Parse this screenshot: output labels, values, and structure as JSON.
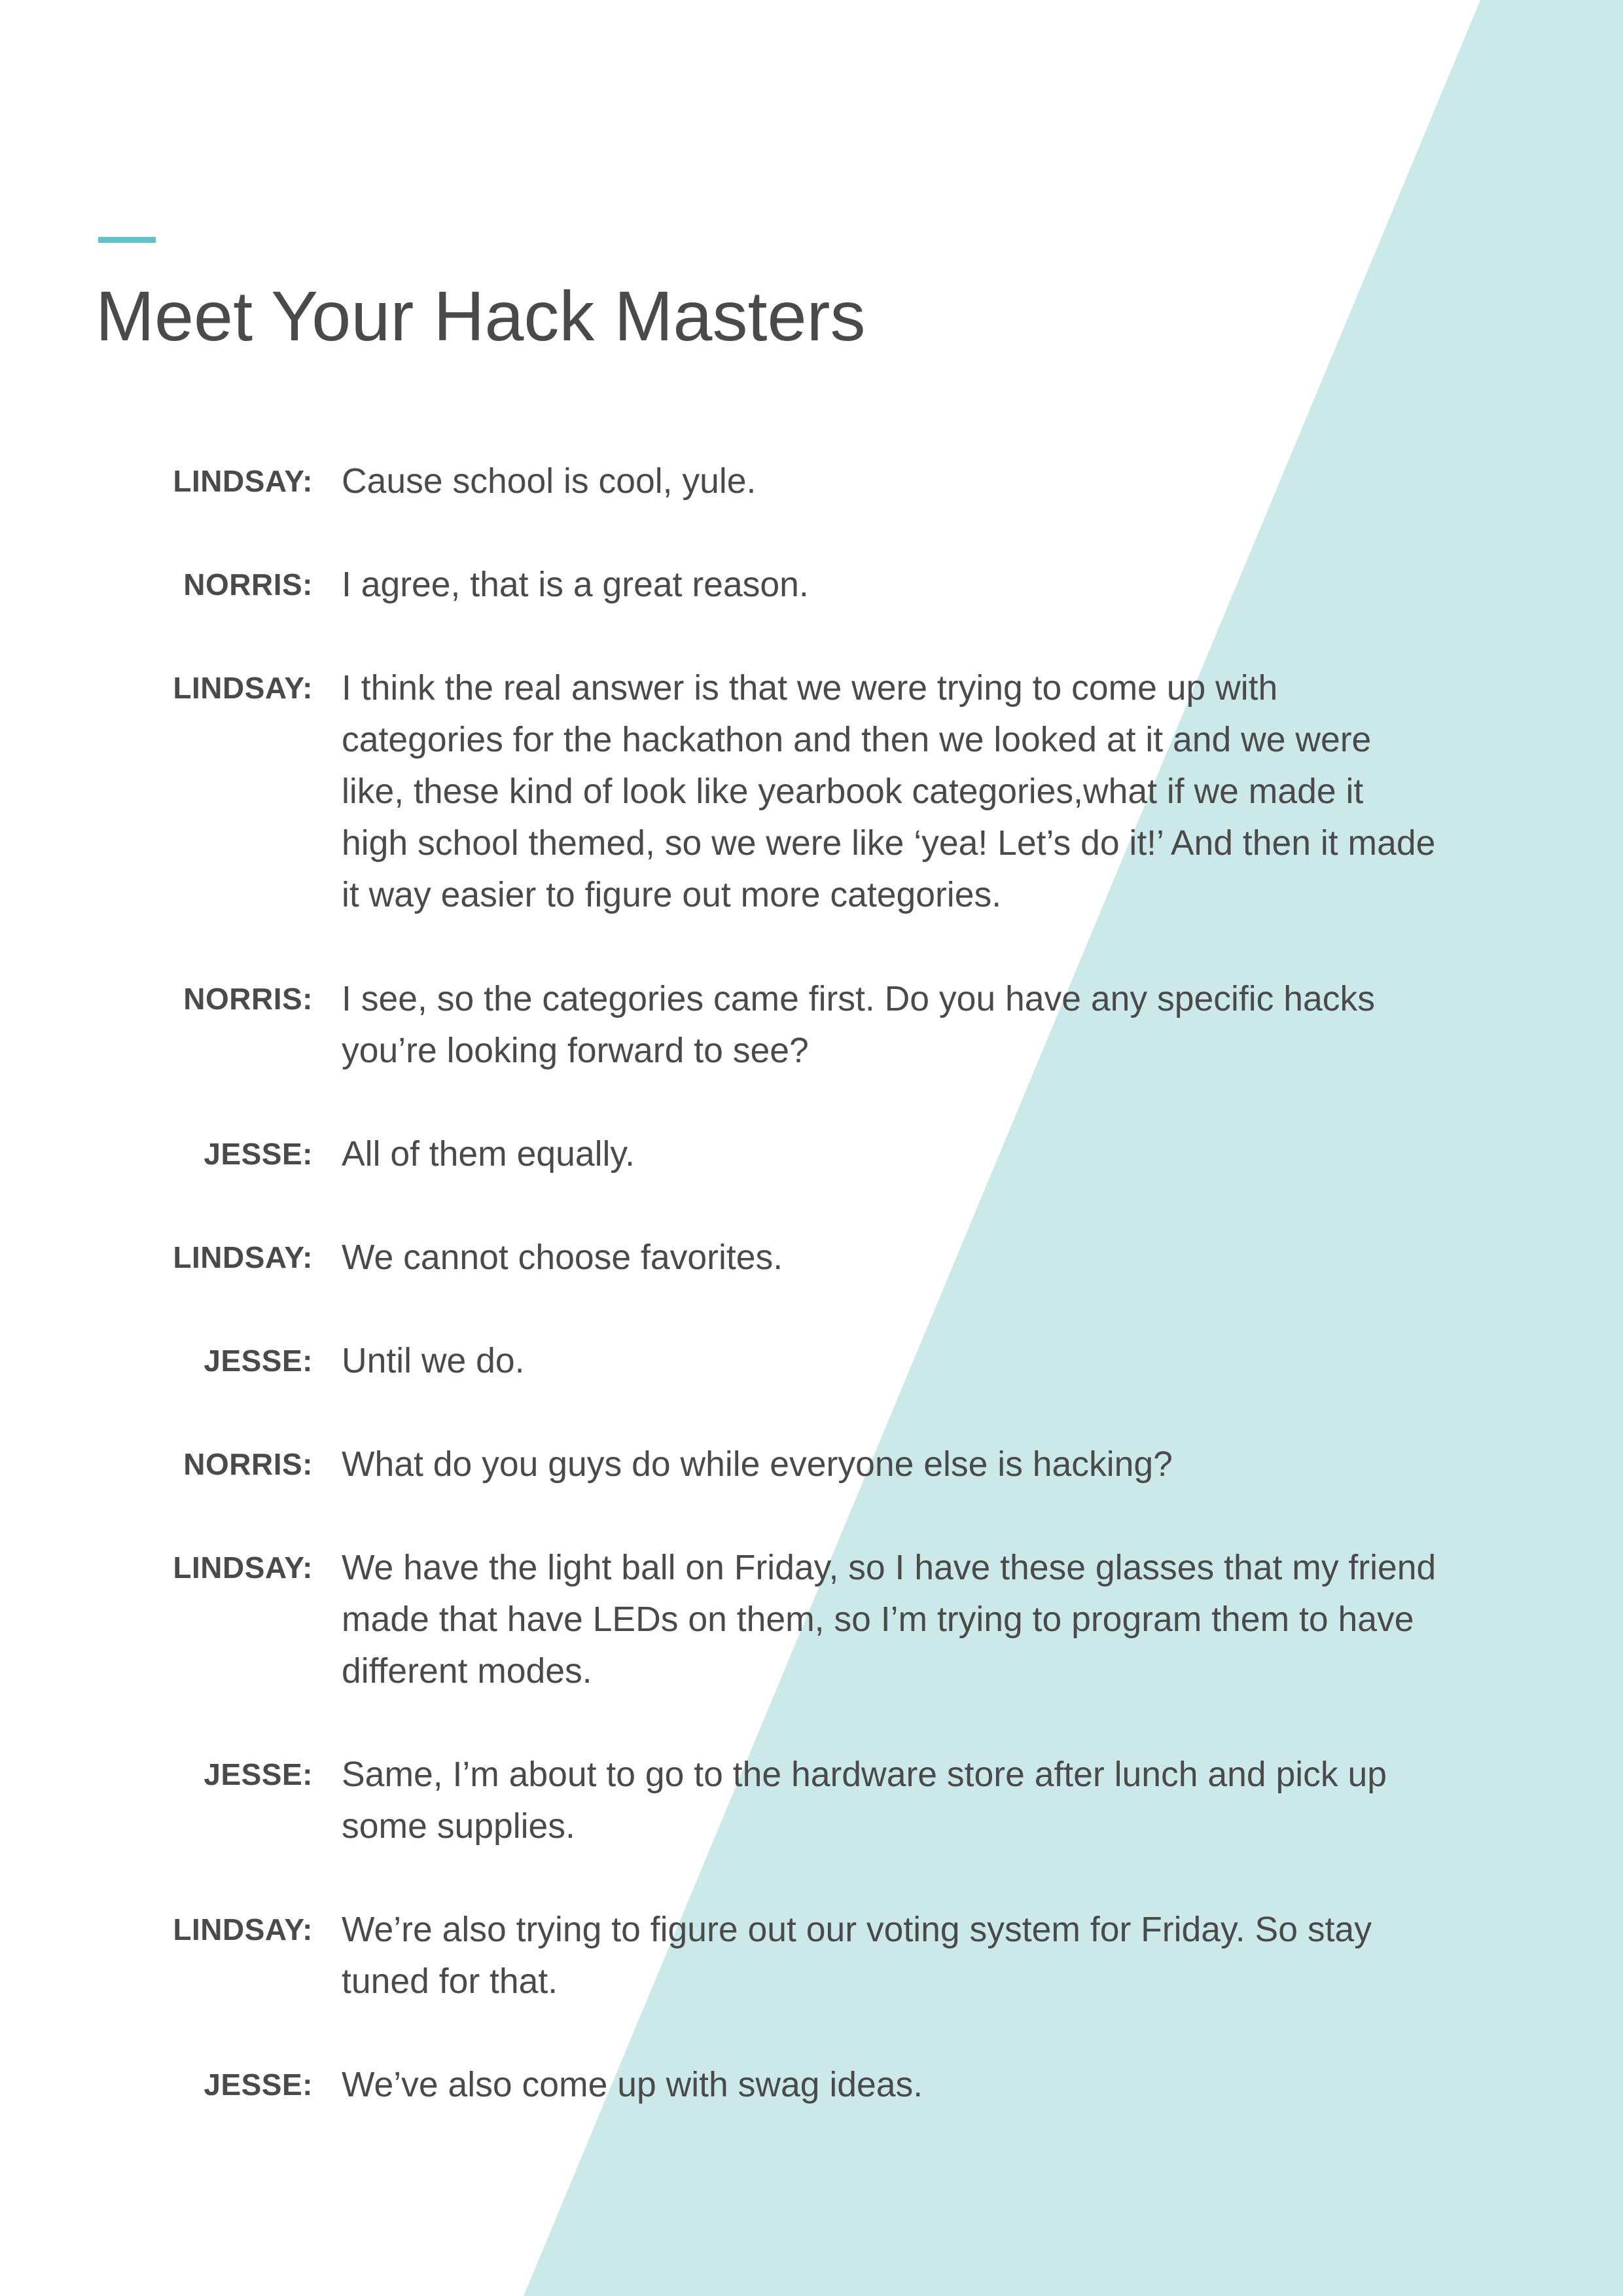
{
  "colors": {
    "accent": "#5fc3c6",
    "background_shape": "#cce9e9",
    "text": "#4a4a4a"
  },
  "page_title": "Meet Your Hack Masters",
  "transcript": [
    {
      "speaker": "LINDSAY:",
      "lines": [
        "Cause school is cool, yule."
      ]
    },
    {
      "speaker": "NORRIS:",
      "lines": [
        "I agree, that is a great reason."
      ]
    },
    {
      "speaker": "LINDSAY:",
      "lines": [
        "I think the real answer is that we were trying to come up with",
        "categories for the hackathon and then we looked at it and we were",
        "like, these kind of look like yearbook categories,what if we made it",
        "high school themed, so we were like ‘yea! Let’s do it!’ And then it made",
        "it way easier to figure out more categories."
      ]
    },
    {
      "speaker": "NORRIS:",
      "lines": [
        "I see, so the categories came first. Do you have any specific hacks",
        "you’re looking forward to see?"
      ]
    },
    {
      "speaker": "JESSE:",
      "lines": [
        "All of them equally."
      ]
    },
    {
      "speaker": "LINDSAY:",
      "lines": [
        "We cannot choose favorites."
      ]
    },
    {
      "speaker": "JESSE:",
      "lines": [
        "Until we do."
      ]
    },
    {
      "speaker": "NORRIS:",
      "lines": [
        "What do you guys do while everyone else is hacking?"
      ]
    },
    {
      "speaker": "LINDSAY:",
      "lines": [
        "We have the light ball on Friday, so I have these glasses that my friend",
        "made that have LEDs on them, so I’m trying to program them to have",
        "different modes."
      ]
    },
    {
      "speaker": "JESSE:",
      "lines": [
        "Same, I’m about to go to the hardware store after lunch and pick up",
        "some supplies."
      ]
    },
    {
      "speaker": "LINDSAY:",
      "lines": [
        "We’re also trying to figure out our voting system for Friday. So stay",
        "tuned for that."
      ]
    },
    {
      "speaker": "JESSE:",
      "lines": [
        "We’ve also come up with swag ideas."
      ]
    }
  ]
}
